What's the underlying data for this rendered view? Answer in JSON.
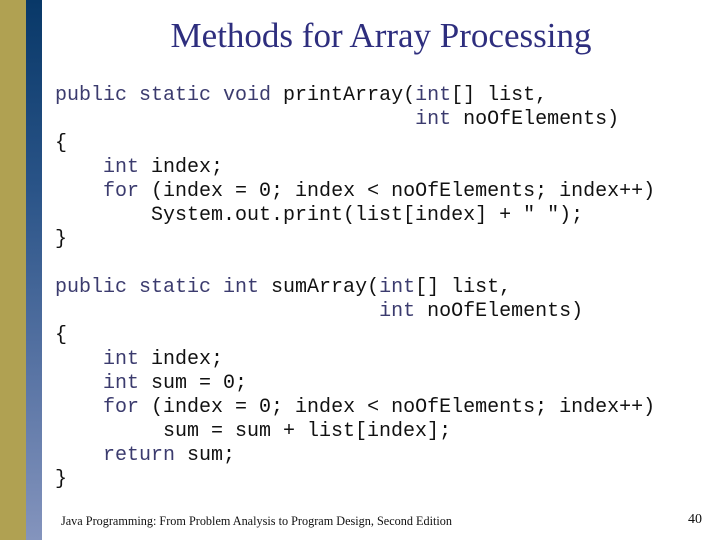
{
  "slide": {
    "title": "Methods for Array Processing",
    "colors": {
      "left_band": "#b0a152",
      "accent_band_top": "#083868",
      "accent_band_bottom": "#8494bd",
      "title": "#2e2e7e",
      "keyword": "#3b3b6e"
    },
    "code_lines": [
      [
        {
          "t": "public static void",
          "kw": true
        },
        {
          "t": " printArray("
        },
        {
          "t": "int",
          "kw": true
        },
        {
          "t": "[] list,"
        }
      ],
      [
        {
          "t": "                              "
        },
        {
          "t": "int",
          "kw": true
        },
        {
          "t": " noOfElements)"
        }
      ],
      [
        {
          "t": "{"
        }
      ],
      [
        {
          "t": "    "
        },
        {
          "t": "int",
          "kw": true
        },
        {
          "t": " index;"
        }
      ],
      [
        {
          "t": "    "
        },
        {
          "t": "for",
          "kw": true
        },
        {
          "t": " (index = 0; index < noOfElements; index++)"
        }
      ],
      [
        {
          "t": "        System.out.print(list[index] + \" \");"
        }
      ],
      [
        {
          "t": "}"
        }
      ],
      [
        {
          "t": ""
        }
      ],
      [
        {
          "t": "public static int",
          "kw": true
        },
        {
          "t": " sumArray("
        },
        {
          "t": "int",
          "kw": true
        },
        {
          "t": "[] list,"
        }
      ],
      [
        {
          "t": "                           "
        },
        {
          "t": "int",
          "kw": true
        },
        {
          "t": " noOfElements)"
        }
      ],
      [
        {
          "t": "{"
        }
      ],
      [
        {
          "t": "    "
        },
        {
          "t": "int",
          "kw": true
        },
        {
          "t": " index;"
        }
      ],
      [
        {
          "t": "    "
        },
        {
          "t": "int",
          "kw": true
        },
        {
          "t": " sum = 0;"
        }
      ],
      [
        {
          "t": "    "
        },
        {
          "t": "for",
          "kw": true
        },
        {
          "t": " (index = 0; index < noOfElements; index++)"
        }
      ],
      [
        {
          "t": "         sum = sum + list[index];"
        }
      ],
      [
        {
          "t": "    "
        },
        {
          "t": "return",
          "kw": true
        },
        {
          "t": " sum;"
        }
      ],
      [
        {
          "t": "}"
        }
      ]
    ],
    "footer": {
      "text": "Java Programming: From Problem Analysis to Program Design, Second Edition",
      "page_number": "40"
    }
  }
}
